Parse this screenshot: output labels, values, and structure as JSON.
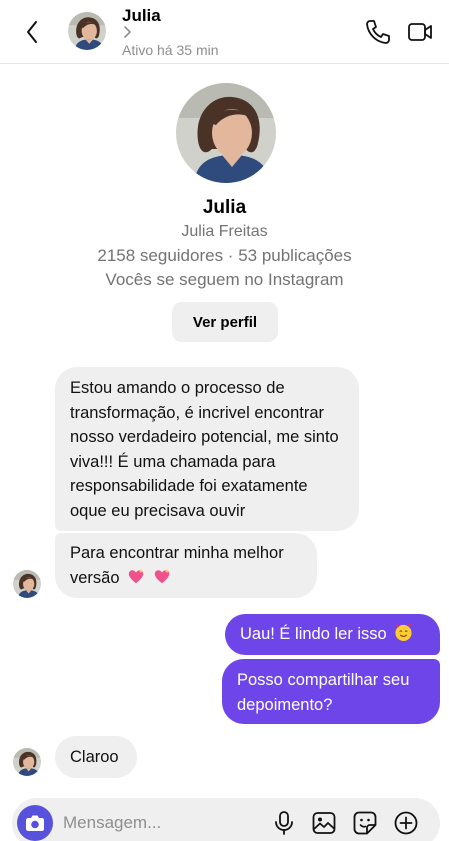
{
  "header": {
    "name": "Julia",
    "status": "Ativo há 35 min"
  },
  "profile": {
    "name": "Julia",
    "full_name": "Julia Freitas",
    "stats": "2158 seguidores · 53 publicações",
    "mutual": "Vocês se seguem no Instagram",
    "view_profile_label": "Ver perfil"
  },
  "messages": [
    {
      "from": "Julia",
      "text": "Estou amando o processo de transformação, é incrivel encontrar nosso verdadeiro potencial, me sinto viva!!! É uma chamada para responsabilidade foi exatamente oque eu precisava ouvir"
    },
    {
      "from": "Julia",
      "text": "Para encontrar minha melhor versão"
    },
    {
      "from": "me",
      "text": "Uau! É lindo ler isso"
    },
    {
      "from": "me",
      "text": "Posso compartilhar seu depoimento?"
    },
    {
      "from": "Julia",
      "text": "Claroo"
    }
  ],
  "composer": {
    "placeholder": "Mensagem..."
  },
  "colors": {
    "outgoing_bubble": "#6e45e9",
    "incoming_bubble": "#efefef",
    "camera_button": "#5851db",
    "muted_text": "#737373"
  }
}
